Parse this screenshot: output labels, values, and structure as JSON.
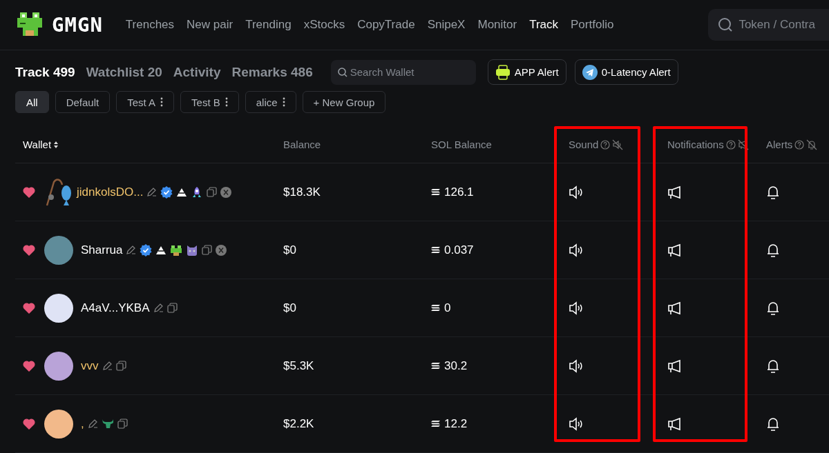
{
  "logo": {
    "text": "GMGN"
  },
  "nav": [
    {
      "label": "Trenches",
      "selected": false
    },
    {
      "label": "New pair",
      "selected": false
    },
    {
      "label": "Trending",
      "selected": false
    },
    {
      "label": "xStocks",
      "selected": false
    },
    {
      "label": "CopyTrade",
      "selected": false
    },
    {
      "label": "SnipeX",
      "selected": false
    },
    {
      "label": "Monitor",
      "selected": false
    },
    {
      "label": "Track",
      "selected": true
    },
    {
      "label": "Portfolio",
      "selected": false
    }
  ],
  "global_search": {
    "placeholder": "Token / Contra"
  },
  "section_tabs": [
    {
      "label": "Track 499",
      "selected": true
    },
    {
      "label": "Watchlist 20",
      "selected": false
    },
    {
      "label": "Activity",
      "selected": false
    },
    {
      "label": "Remarks 486",
      "selected": false
    }
  ],
  "wallet_search": {
    "placeholder": "Search Wallet"
  },
  "alert_buttons": [
    {
      "label": "APP Alert",
      "kind": "app"
    },
    {
      "label": "0-Latency Alert",
      "kind": "telegram"
    }
  ],
  "groups": [
    {
      "label": "All",
      "selected": true,
      "menu": false
    },
    {
      "label": "Default",
      "selected": false,
      "menu": false
    },
    {
      "label": "Test A",
      "selected": false,
      "menu": true
    },
    {
      "label": "Test B",
      "selected": false,
      "menu": true
    },
    {
      "label": "alice",
      "selected": false,
      "menu": true
    },
    {
      "label": "+ New Group",
      "selected": false,
      "menu": false
    }
  ],
  "columns": [
    {
      "label": "Wallet",
      "kind": "sortable"
    },
    {
      "label": "Balance",
      "kind": "plain"
    },
    {
      "label": "SOL Balance",
      "kind": "plain"
    },
    {
      "label": "Sound",
      "kind": "sound",
      "highlighted": true
    },
    {
      "label": "Notifications",
      "kind": "notify",
      "highlighted": true
    },
    {
      "label": "Alerts",
      "kind": "alert",
      "highlighted": false
    }
  ],
  "rows": [
    {
      "name": "jidnkolsDO...",
      "remarked": true,
      "favorite": true,
      "avatar": {
        "kind": "emoji"
      },
      "badges": [
        {
          "kind": "verified"
        },
        {
          "kind": "tier"
        },
        {
          "kind": "rocket"
        }
      ],
      "twitter": true,
      "balance": "$18.3K",
      "sol": "126.1",
      "sound": true,
      "notify": true,
      "alert": true
    },
    {
      "name": "Sharrua",
      "remarked": false,
      "favorite": true,
      "avatar": {
        "kind": "photo"
      },
      "badges": [
        {
          "kind": "verified"
        },
        {
          "kind": "tier"
        },
        {
          "kind": "frog"
        },
        {
          "kind": "cat"
        }
      ],
      "twitter": true,
      "balance": "$0",
      "sol": "0.037",
      "sound": true,
      "notify": true,
      "alert": true
    },
    {
      "name": "A4aV...YKBA",
      "remarked": false,
      "favorite": true,
      "avatar": {
        "kind": "pixel-blue"
      },
      "twitter": false,
      "balance": "$0",
      "sol": "0",
      "sound": true,
      "notify": true,
      "alert": true
    },
    {
      "name": "vvv",
      "remarked": true,
      "favorite": true,
      "avatar": {
        "kind": "pixel-purple"
      },
      "twitter": false,
      "balance": "$5.3K",
      "sol": "30.2",
      "sound": true,
      "notify": true,
      "alert": true
    },
    {
      "name": ",",
      "remarked": true,
      "favorite": true,
      "avatar": {
        "kind": "pixel-orange"
      },
      "badges": [
        {
          "kind": "bull"
        }
      ],
      "twitter": false,
      "balance": "$2.2K",
      "sol": "12.2",
      "sound": true,
      "notify": true,
      "alert": true
    }
  ]
}
